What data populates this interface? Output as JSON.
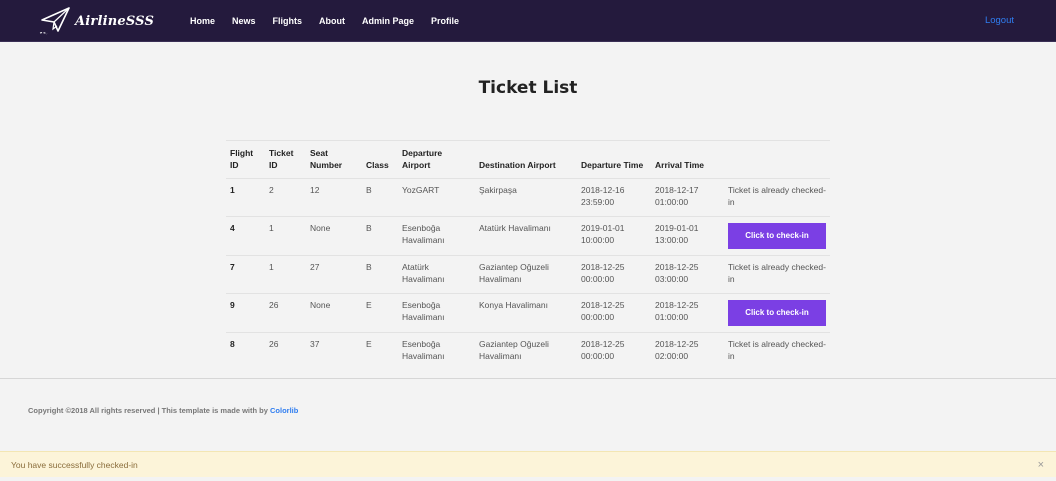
{
  "brand": {
    "name": "AirlineSSS"
  },
  "nav": {
    "links": [
      "Home",
      "News",
      "Flights",
      "About",
      "Admin Page",
      "Profile"
    ],
    "logout": "Logout"
  },
  "page": {
    "title": "Ticket List"
  },
  "table": {
    "headers": {
      "flight_id": "Flight ID",
      "ticket_id": "Ticket ID",
      "seat_number": "Seat Number",
      "class": "Class",
      "departure_airport": "Departure Airport",
      "destination_airport": "Destination Airport",
      "departure_time": "Departure Time",
      "arrival_time": "Arrival Time"
    },
    "rows": [
      {
        "flight_id": "1",
        "ticket_id": "2",
        "seat": "12",
        "class": "B",
        "departure": "YozGART",
        "destination": "Şakirpaşa",
        "departure_time": "2018-12-16 23:59:00",
        "arrival_time": "2018-12-17 01:00:00",
        "action": "Ticket is already checked-in",
        "action_type": "text"
      },
      {
        "flight_id": "4",
        "ticket_id": "1",
        "seat": "None",
        "class": "B",
        "departure": "Esenboğa Havalimanı",
        "destination": "Atatürk Havalimanı",
        "departure_time": "2019-01-01 10:00:00",
        "arrival_time": "2019-01-01 13:00:00",
        "action": "Click to check-in",
        "action_type": "button"
      },
      {
        "flight_id": "7",
        "ticket_id": "1",
        "seat": "27",
        "class": "B",
        "departure": "Atatürk Havalimanı",
        "destination": "Gaziantep Oğuzeli Havalimanı",
        "departure_time": "2018-12-25 00:00:00",
        "arrival_time": "2018-12-25 03:00:00",
        "action": "Ticket is already checked-in",
        "action_type": "text"
      },
      {
        "flight_id": "9",
        "ticket_id": "26",
        "seat": "None",
        "class": "E",
        "departure": "Esenboğa Havalimanı",
        "destination": "Konya Havalimanı",
        "departure_time": "2018-12-25 00:00:00",
        "arrival_time": "2018-12-25 01:00:00",
        "action": "Click to check-in",
        "action_type": "button"
      },
      {
        "flight_id": "8",
        "ticket_id": "26",
        "seat": "37",
        "class": "E",
        "departure": "Esenboğa Havalimanı",
        "destination": "Gaziantep Oğuzeli Havalimanı",
        "departure_time": "2018-12-25 00:00:00",
        "arrival_time": "2018-12-25 02:00:00",
        "action": "Ticket is already checked-in",
        "action_type": "text"
      }
    ]
  },
  "footer": {
    "text": "Copyright ©2018 All rights reserved | This template is made with  by ",
    "link": "Colorlib"
  },
  "alert": {
    "message": "You have successfully checked-in",
    "close": "×"
  },
  "colors": {
    "navbar": "#241a3d",
    "accent": "#7b3fe4",
    "link": "#2f7df0",
    "alert_bg": "#fcf4d9"
  }
}
